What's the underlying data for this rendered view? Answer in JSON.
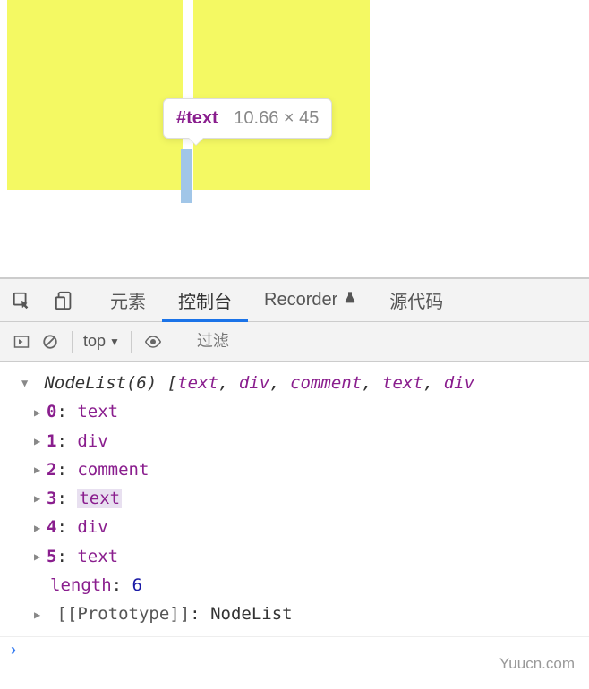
{
  "tooltip": {
    "selector": "#text",
    "dimensions": "10.66 × 45"
  },
  "tabs": {
    "elements": "元素",
    "console": "控制台",
    "recorder": "Recorder",
    "sources": "源代码"
  },
  "toolbar": {
    "context": "top",
    "filter_placeholder": "过滤"
  },
  "output": {
    "header_prefix": "NodeList(6)",
    "header_items": [
      "text",
      "div",
      "comment",
      "text",
      "div"
    ],
    "entries": [
      {
        "index": "0",
        "value": "text",
        "hl": false
      },
      {
        "index": "1",
        "value": "div",
        "hl": false
      },
      {
        "index": "2",
        "value": "comment",
        "hl": false
      },
      {
        "index": "3",
        "value": "text",
        "hl": true
      },
      {
        "index": "4",
        "value": "div",
        "hl": false
      },
      {
        "index": "5",
        "value": "text",
        "hl": false
      }
    ],
    "length_label": "length",
    "length_value": "6",
    "prototype_label": "[[Prototype]]",
    "prototype_value": "NodeList"
  },
  "watermark": "Yuucn.com"
}
